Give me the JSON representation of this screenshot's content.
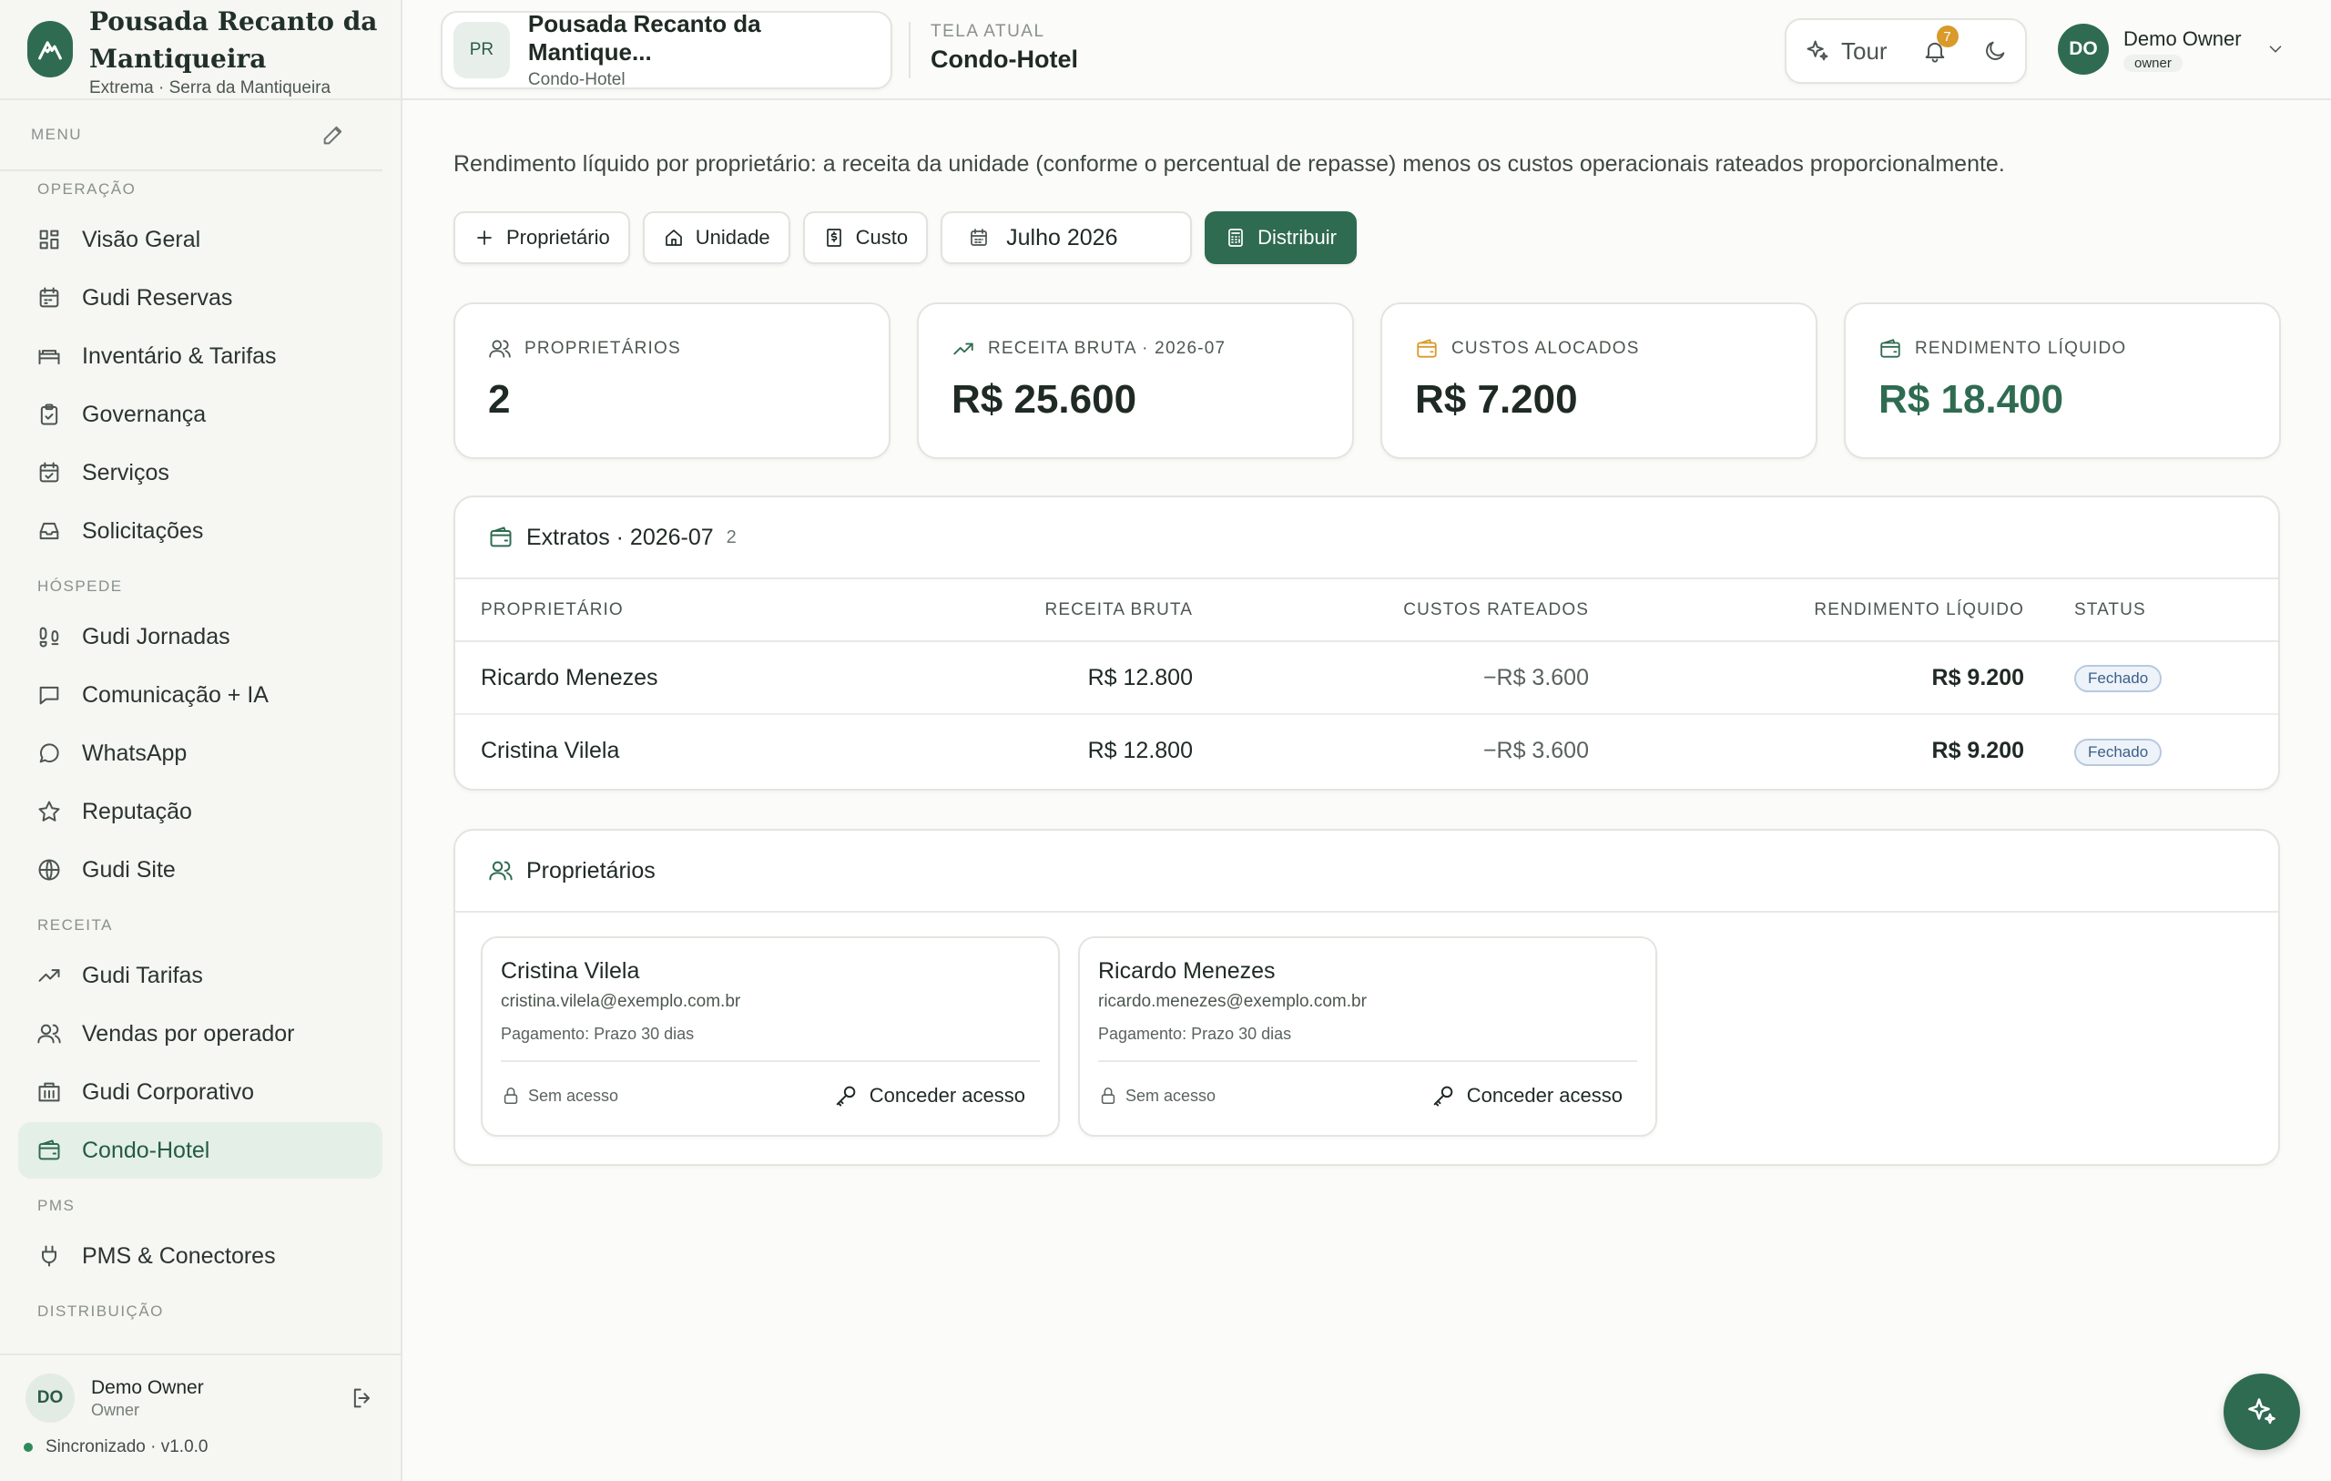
{
  "brand": {
    "name": "Pousada Recanto da Mantiqueira",
    "subtitle": "Extrema · Serra da Mantiqueira",
    "logo_icon": "mountain-icon"
  },
  "sidebar": {
    "menu_label": "MENU",
    "sections": [
      {
        "title": "OPERAÇÃO",
        "items": [
          {
            "label": "Visão Geral",
            "icon": "grid-icon"
          },
          {
            "label": "Gudi Reservas",
            "icon": "calendar-icon"
          },
          {
            "label": "Inventário & Tarifas",
            "icon": "bed-icon"
          },
          {
            "label": "Governança",
            "icon": "clipboard-icon"
          },
          {
            "label": "Serviços",
            "icon": "calendar-check-icon"
          },
          {
            "label": "Solicitações",
            "icon": "inbox-icon"
          }
        ]
      },
      {
        "title": "HÓSPEDE",
        "items": [
          {
            "label": "Gudi Jornadas",
            "icon": "footprints-icon"
          },
          {
            "label": "Comunicação + IA",
            "icon": "message-square-icon"
          },
          {
            "label": "WhatsApp",
            "icon": "message-circle-icon"
          },
          {
            "label": "Reputação",
            "icon": "star-icon"
          },
          {
            "label": "Gudi Site",
            "icon": "globe-icon"
          }
        ]
      },
      {
        "title": "RECEITA",
        "items": [
          {
            "label": "Gudi Tarifas",
            "icon": "trending-up-icon"
          },
          {
            "label": "Vendas por operador",
            "icon": "users-icon"
          },
          {
            "label": "Gudi Corporativo",
            "icon": "building-icon"
          },
          {
            "label": "Condo-Hotel",
            "icon": "wallet-icon",
            "active": true
          }
        ]
      },
      {
        "title": "PMS",
        "items": [
          {
            "label": "PMS & Conectores",
            "icon": "plug-icon"
          }
        ]
      },
      {
        "title": "DISTRIBUIÇÃO",
        "items": []
      }
    ],
    "user": {
      "initials": "DO",
      "name": "Demo Owner",
      "role": "Owner"
    },
    "sync_status": "Sincronizado · v1.0.0"
  },
  "topbar": {
    "property": {
      "initials": "PR",
      "name": "Pousada Recanto da Mantique...",
      "type": "Condo-Hotel"
    },
    "screen_label": "TELA ATUAL",
    "screen_value": "Condo-Hotel",
    "tour_label": "Tour",
    "notifications": "7",
    "user": {
      "initials": "DO",
      "name": "Demo Owner",
      "role": "owner"
    }
  },
  "main": {
    "description": "Rendimento líquido por proprietário: a receita da unidade (conforme o percentual de repasse) menos os custos operacionais rateados proporcionalmente.",
    "actions": {
      "add_owner": "Proprietário",
      "add_unit": "Unidade",
      "add_cost": "Custo",
      "month": "Julho 2026",
      "distribute": "Distribuir"
    },
    "stats": [
      {
        "label": "PROPRIETÁRIOS",
        "value": "2",
        "icon": "users-icon"
      },
      {
        "label": "RECEITA BRUTA · 2026-07",
        "value": "R$ 25.600",
        "icon": "trending-up-icon"
      },
      {
        "label": "CUSTOS ALOCADOS",
        "value": "R$ 7.200",
        "icon": "wallet-icon"
      },
      {
        "label": "RENDIMENTO LÍQUIDO",
        "value": "R$ 18.400",
        "icon": "wallet-icon"
      }
    ],
    "statements": {
      "title": "Extratos · 2026-07",
      "count": "2",
      "columns": [
        "PROPRIETÁRIO",
        "RECEITA BRUTA",
        "CUSTOS RATEADOS",
        "RENDIMENTO LÍQUIDO",
        "STATUS"
      ],
      "rows": [
        {
          "owner": "Ricardo Menezes",
          "gross": "R$ 12.800",
          "costs": "−R$ 3.600",
          "net": "R$ 9.200",
          "status": "Fechado"
        },
        {
          "owner": "Cristina Vilela",
          "gross": "R$ 12.800",
          "costs": "−R$ 3.600",
          "net": "R$ 9.200",
          "status": "Fechado"
        }
      ]
    },
    "owners": {
      "title": "Proprietários",
      "items": [
        {
          "name": "Cristina Vilela",
          "email": "cristina.vilela@exemplo.com.br",
          "payment": "Pagamento: Prazo 30 dias",
          "access": "Sem acesso",
          "grant": "Conceder acesso"
        },
        {
          "name": "Ricardo Menezes",
          "email": "ricardo.menezes@exemplo.com.br",
          "payment": "Pagamento: Prazo 30 dias",
          "access": "Sem acesso",
          "grant": "Conceder acesso"
        }
      ]
    }
  },
  "fab_icon": "sparkles-icon",
  "colors": {
    "accent": "#2f6b51",
    "sidebar_bg": "#f6f6f3",
    "badge": "#d99a2b",
    "status_pill": "#3a5f8a"
  }
}
